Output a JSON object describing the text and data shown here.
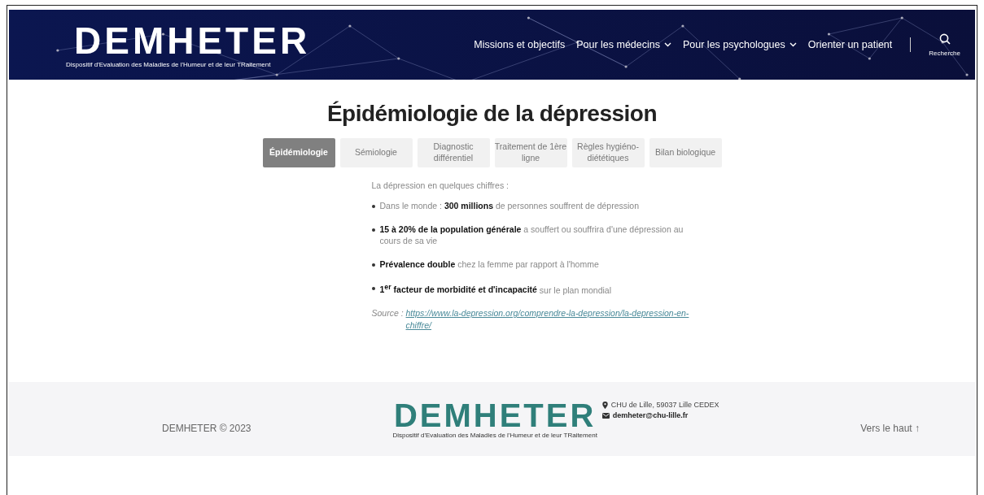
{
  "header": {
    "logo": "DEMHETER",
    "tagline": "Dispositif d'Evaluation des Maladies de l'Humeur et de leur TRaitement",
    "nav": [
      {
        "label": "Missions et objectifs",
        "dropdown": false
      },
      {
        "label": "Pour les médecins",
        "dropdown": true
      },
      {
        "label": "Pour les psychologues",
        "dropdown": true
      },
      {
        "label": "Orienter un patient",
        "dropdown": false
      }
    ],
    "search_label": "Recherche"
  },
  "title": "Épidémiologie de la dépression",
  "tabs": [
    {
      "label": "Épidémiologie",
      "selected": true
    },
    {
      "label": "Sémiologie",
      "selected": false
    },
    {
      "label": "Diagnostic différentiel",
      "selected": false
    },
    {
      "label": "Traitement de 1ère ligne",
      "selected": false
    },
    {
      "label": "Règles hygiéno-diététiques",
      "selected": false
    },
    {
      "label": "Bilan biologique",
      "selected": false
    }
  ],
  "intro": "La dépression en quelques chiffres :",
  "bullets": [
    "Dans le monde : **300 millions** de personnes souffrent de dépression",
    "**15 à 20% de la population générale** a souffert ou souffrira d'une dépression au cours de sa vie",
    "**Prévalence double** chez la femme par rapport à l'homme",
    "**1$^{er}$  facteur de morbidité et d'incapacité** sur le plan mondial"
  ],
  "source": {
    "prefix": "Source : ",
    "link": "https://www.la-depression.org/comprendre-la-depression/la-depression-en-chiffre/"
  },
  "footer": {
    "copyright": "DEMHETER © 2023",
    "logo": "DEMHETER",
    "tagline": "Dispositif d'Evaluation des Maladies de l'Humeur et de leur TRaitement",
    "address": "CHU de Lille, 59037 Lille CEDEX",
    "email": "demheter@chu-lille.fr",
    "back_to_top": "Vers le haut ↑"
  }
}
